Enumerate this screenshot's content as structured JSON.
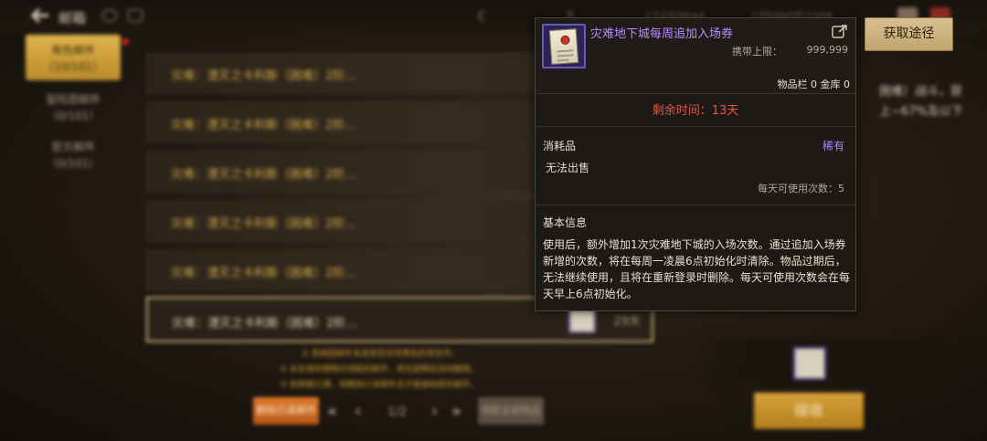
{
  "topbar": {
    "title": "邮箱",
    "currency_left": "123万9044",
    "currency_right": "1Z5060万2208",
    "count": "0"
  },
  "sidebar": {
    "tabs": [
      {
        "label": "角色邮件",
        "count": "（10/101）"
      },
      {
        "label": "冒险团邮件",
        "count": "（0/101）"
      },
      {
        "label": "官方邮件",
        "count": "（0/101）"
      }
    ]
  },
  "mails": {
    "items": [
      {
        "title": "灾难：湮灭之卡利斯（困难）2阶...",
        "days": ""
      },
      {
        "title": "灾难：湮灭之卡利斯（困难）2阶...",
        "days": ""
      },
      {
        "title": "灾难：湮灭之卡利斯（困难）2阶...",
        "days": ""
      },
      {
        "title": "灾难：湮灭之卡利斯（困难）2阶...",
        "days": ""
      },
      {
        "title": "灾难：湮灭之卡利斯（困难）2阶...",
        "days": ""
      },
      {
        "title": "灾难：湮灭之卡利斯（困难）2阶...",
        "days": "29天"
      }
    ]
  },
  "notices": [
    "① 若她团邮件未发放至任何角色的背包中。",
    "② 未在保存期限内领取的邮件，将在超期后自动删除。",
    "③ 若邮箱已满，将删除已读邮件且才能接收新的邮件。"
  ],
  "pager": {
    "text": "1/2"
  },
  "buttons": {
    "delete_read": "删除已读邮件",
    "claim_all": "领取全部物品",
    "receive": "接收",
    "get_path": "获取途径"
  },
  "detail": {
    "line1": "困难）战斗，获",
    "line2": "上~67%及以下"
  },
  "tooltip": {
    "item_name": "灾难地下城每周追加入场券",
    "carry_limit_label": "携带上限：",
    "carry_limit_value": "999,999",
    "storage": "物品栏 0 金库 0",
    "remaining": "剩余时间：13天",
    "category": "消耗品",
    "rarity": "稀有",
    "no_sell": "无法出售",
    "daily_uses": "每天可使用次数：5",
    "section_title": "基本信息",
    "description": "使用后，额外增加1次灾难地下城的入场次数。通过追加入场券新增的次数，将在每周一凌晨6点初始化时清除。物品过期后，无法继续使用，且将在重新登录时删除。每天可使用次数会在每天早上6点初始化。"
  },
  "colors": {
    "item_name": "#b98cff",
    "remaining": "#e5564a",
    "rarity": "#a885ff",
    "accent_gold": "#d8a23a"
  }
}
